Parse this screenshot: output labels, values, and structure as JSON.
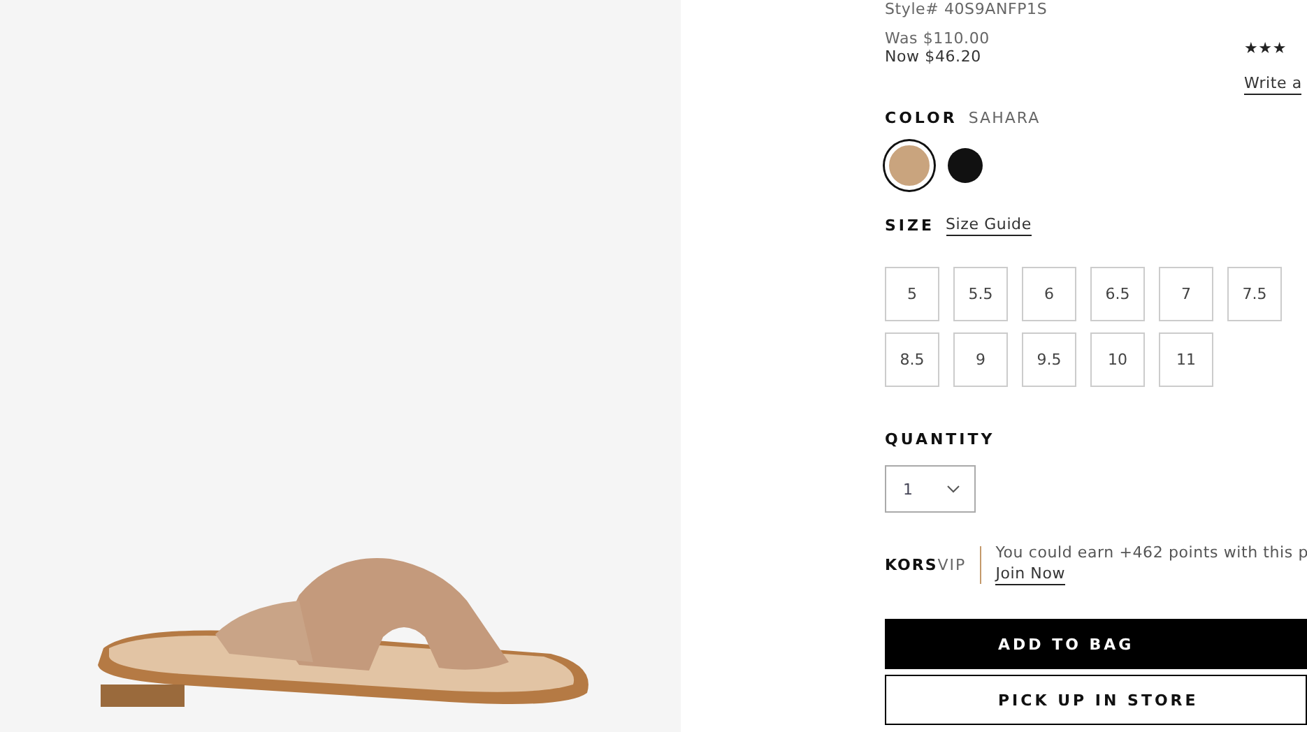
{
  "product": {
    "style": "Style# 40S9ANFP1S",
    "was_price": "Was $110.00",
    "now_price": "Now $46.20",
    "rating_stars": "★★★",
    "review_link": "Write a"
  },
  "color": {
    "label": "COLOR",
    "value": "SAHARA",
    "swatches": [
      {
        "color": "#c9a47e",
        "selected": true
      },
      {
        "color": "#111111",
        "selected": false
      }
    ]
  },
  "size": {
    "label": "SIZE",
    "guide_link": "Size Guide",
    "options": [
      {
        "label": "5",
        "selected": false
      },
      {
        "label": "5.5",
        "selected": false
      },
      {
        "label": "6",
        "selected": false
      },
      {
        "label": "6.5",
        "selected": false
      },
      {
        "label": "7",
        "selected": false
      },
      {
        "label": "7.5",
        "selected": false
      },
      {
        "label": "8.5",
        "selected": false
      },
      {
        "label": "9",
        "selected": false
      },
      {
        "label": "9.5",
        "selected": false
      },
      {
        "label": "10",
        "selected": false
      },
      {
        "label": "11",
        "selected": false
      }
    ]
  },
  "quantity": {
    "label": "QUANTITY",
    "value": "1"
  },
  "vip": {
    "brand_bold": "KORS",
    "brand_light": "VIP",
    "message": "You could earn +462 points with this p",
    "join_link": "Join Now"
  },
  "buttons": [
    {
      "kind": "primary",
      "label": "ADD TO BAG"
    },
    {
      "kind": "secondary",
      "label": "PICK UP IN STORE"
    }
  ]
}
